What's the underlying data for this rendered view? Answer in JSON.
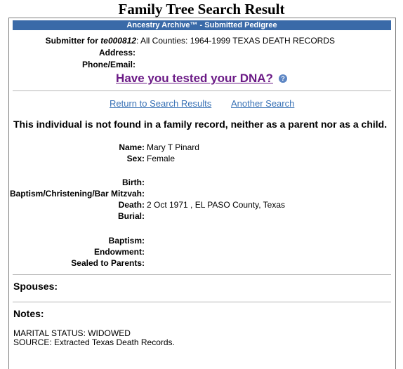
{
  "page": {
    "title": "Family Tree Search Result"
  },
  "banner": {
    "text": "Ancestry Archive™ - Submitted Pedigree"
  },
  "submitter": {
    "label": "Submitter for",
    "id": "te000812",
    "value": ": All Counties: 1964-1999 TEXAS DEATH RECORDS",
    "address_label": "Address:",
    "phone_label": "Phone/Email:"
  },
  "dna": {
    "link_text": "Have you tested your DNA?",
    "help_icon": "?"
  },
  "nav": {
    "return_label": "Return to Search Results",
    "another_label": "Another Search"
  },
  "notice": "This individual is not found in a family record, neither as a parent nor as a child.",
  "person": {
    "name_label": "Name:",
    "name": "Mary T Pinard",
    "sex_label": "Sex:",
    "sex": "Female",
    "birth_label": "Birth:",
    "baptism_christening_label": "Baptism/Christening/Bar Mitzvah:",
    "death_label": "Death:",
    "death": "2 Oct 1971 , EL PASO County, Texas",
    "burial_label": "Burial:",
    "baptism_label": "Baptism:",
    "endowment_label": "Endowment:",
    "sealed_label": "Sealed to Parents:"
  },
  "sections": {
    "spouses": "Spouses:",
    "notes": "Notes:"
  },
  "notes": {
    "line1": "MARITAL STATUS: WIDOWED",
    "line2": "SOURCE: Extracted Texas Death Records."
  }
}
